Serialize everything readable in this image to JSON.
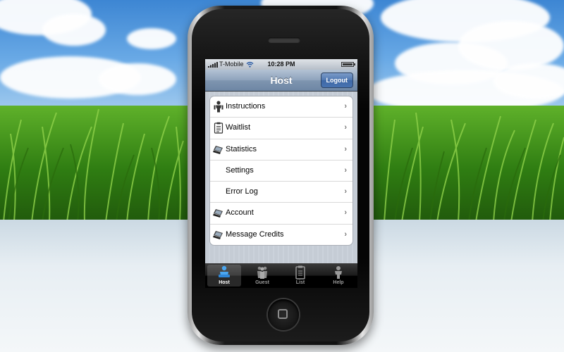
{
  "status_bar": {
    "carrier": "T-Mobile",
    "time": "10:28 PM"
  },
  "nav_bar": {
    "title": "Host",
    "logout_label": "Logout"
  },
  "menu": {
    "items": [
      {
        "label": "Instructions",
        "icon": "person-icon"
      },
      {
        "label": "Waitlist",
        "icon": "clipboard-icon"
      },
      {
        "label": "Statistics",
        "icon": "laptop-icon"
      },
      {
        "label": "Settings",
        "icon": ""
      },
      {
        "label": "Error Log",
        "icon": ""
      },
      {
        "label": "Account",
        "icon": "laptop-icon"
      },
      {
        "label": "Message Credits",
        "icon": "laptop-icon"
      }
    ],
    "chevron": "›"
  },
  "tab_bar": {
    "tabs": [
      {
        "label": "Host",
        "icon": "host-icon",
        "active": true
      },
      {
        "label": "Guest",
        "icon": "group-icon",
        "active": false
      },
      {
        "label": "List",
        "icon": "list-icon",
        "active": false
      },
      {
        "label": "Help",
        "icon": "help-icon",
        "active": false
      }
    ]
  },
  "colors": {
    "nav_bar": "#7f95b0",
    "logout_button": "#4772b0",
    "tab_bar": "#000000"
  }
}
